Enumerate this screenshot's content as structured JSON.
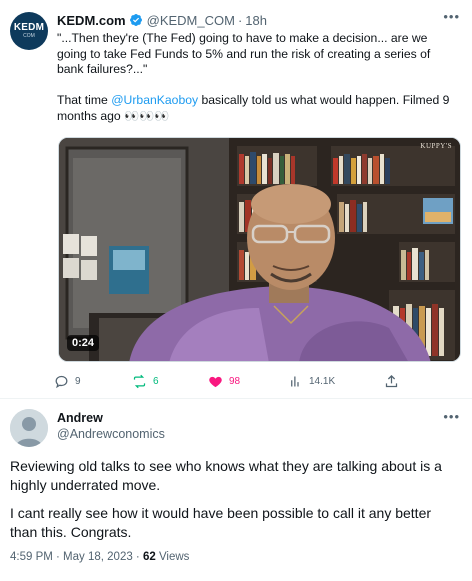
{
  "tweet1": {
    "avatar_text": "KEDM",
    "avatar_subtext": "COM",
    "display_name": "KEDM.com",
    "handle": "@KEDM_COM",
    "separator": "·",
    "time": "18h",
    "more": "•••",
    "text_p1": "\"...Then they're (The Fed) going to have to make a decision... are we going to take Fed Funds to 5% and run the risk of creating a series of bank failures?...\"",
    "text_p2_before": "That time ",
    "text_p2_mention": "@UrbanKaoboy",
    "text_p2_after": " basically told us what would happen. Filmed 9 months ago 👀👀👀",
    "media": {
      "duration": "0:24",
      "watermark": "KUPPY'S"
    },
    "actions": {
      "replies": "9",
      "retweets": "6",
      "likes": "98",
      "views": "14.1K"
    },
    "colors": {
      "accent": "#1d9bf0",
      "retweet": "#00ba7c",
      "like": "#f91880",
      "muted": "#536471"
    }
  },
  "tweet2": {
    "display_name": "Andrew",
    "handle": "@Andrewconomics",
    "more": "•••",
    "text_p1": "Reviewing old talks to see who knows what they are talking about is a highly underrated move.",
    "text_p2": "I cant really see how it would have been possible to call it any better than this. Congrats.",
    "timestamp": "4:59 PM · May 18, 2023 · ",
    "views_count": "62",
    "views_label": " Views"
  }
}
